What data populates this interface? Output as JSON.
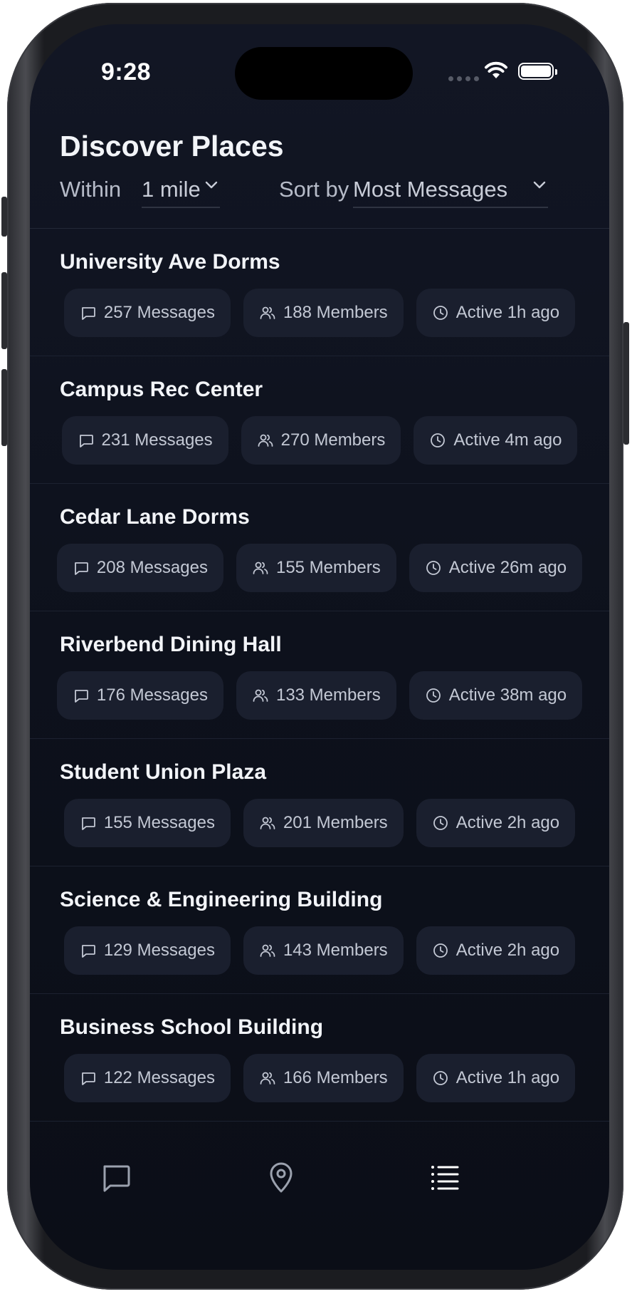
{
  "status_bar": {
    "time": "9:28"
  },
  "header": {
    "title": "Discover Places",
    "within_label": "Within",
    "within_value": "1 mile",
    "sort_label": "Sort by",
    "sort_value": "Most Messages"
  },
  "places": [
    {
      "name": "University Ave Dorms",
      "messages": "257 Messages",
      "members": "188 Members",
      "active": "Active 1h ago"
    },
    {
      "name": "Campus Rec Center",
      "messages": "231 Messages",
      "members": "270 Members",
      "active": "Active 4m ago"
    },
    {
      "name": "Cedar Lane Dorms",
      "messages": "208 Messages",
      "members": "155 Members",
      "active": "Active 26m ago"
    },
    {
      "name": "Riverbend Dining Hall",
      "messages": "176 Messages",
      "members": "133 Members",
      "active": "Active 38m ago"
    },
    {
      "name": "Student Union Plaza",
      "messages": "155 Messages",
      "members": "201 Members",
      "active": "Active 2h ago"
    },
    {
      "name": "Science & Engineering Building",
      "messages": "129 Messages",
      "members": "143 Members",
      "active": "Active 2h ago"
    },
    {
      "name": "Business School Building",
      "messages": "122 Messages",
      "members": "166 Members",
      "active": "Active 1h ago"
    }
  ],
  "tab_bar": {
    "tabs": [
      {
        "icon": "chat-icon"
      },
      {
        "icon": "map-pin-icon"
      },
      {
        "icon": "list-icon"
      }
    ]
  },
  "colors": {
    "background": "#0d111c",
    "chip": "#1a1f2e",
    "text": "#eef0f6",
    "muted_text": "#b6bbc8"
  }
}
